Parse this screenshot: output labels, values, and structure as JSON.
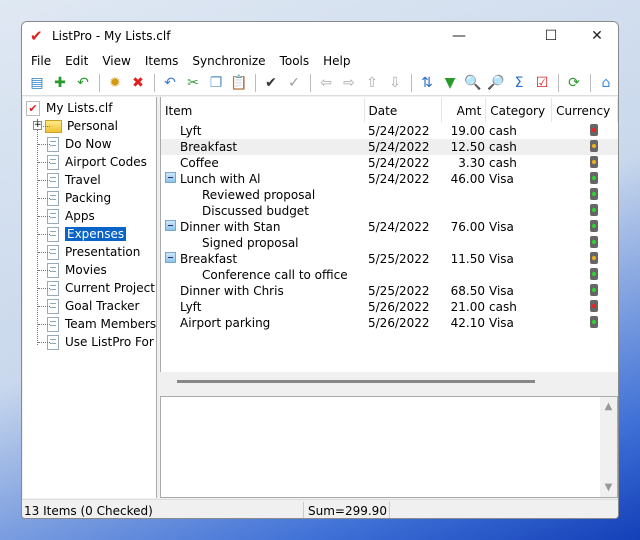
{
  "window": {
    "title": "ListPro - My Lists.clf",
    "minimize": "—",
    "maximize": "☐",
    "close": "✕"
  },
  "menu": [
    "File",
    "Edit",
    "View",
    "Items",
    "Synchronize",
    "Tools",
    "Help"
  ],
  "toolbar": [
    {
      "icon": "new-list-icon",
      "glyph": "▤",
      "color": "#2a7fc9"
    },
    {
      "icon": "add-item-icon",
      "glyph": "✚",
      "color": "#2a9a2a"
    },
    {
      "icon": "import-icon",
      "glyph": "↶",
      "color": "#2a9a2a"
    },
    "sep",
    {
      "icon": "settings-icon",
      "glyph": "✹",
      "color": "#d59a12"
    },
    {
      "icon": "delete-icon",
      "glyph": "✖",
      "color": "#e02020"
    },
    "sep",
    {
      "icon": "undo-icon",
      "glyph": "↶",
      "color": "#3a7cc9"
    },
    {
      "icon": "cut-icon",
      "glyph": "✂",
      "color": "#3a9a3a"
    },
    {
      "icon": "copy-icon",
      "glyph": "❐",
      "color": "#5a8fc9"
    },
    {
      "icon": "paste-icon",
      "glyph": "📋",
      "color": "#888"
    },
    "sep",
    {
      "icon": "check-icon",
      "glyph": "✔",
      "color": "#333"
    },
    {
      "icon": "uncheck-icon",
      "glyph": "✓",
      "color": "#999"
    },
    "sep",
    {
      "icon": "arrow-left-icon",
      "glyph": "⇦",
      "color": "#aaa"
    },
    {
      "icon": "arrow-right-icon",
      "glyph": "⇨",
      "color": "#aaa"
    },
    {
      "icon": "arrow-up-icon",
      "glyph": "⇧",
      "color": "#aaa"
    },
    {
      "icon": "arrow-down-icon",
      "glyph": "⇩",
      "color": "#aaa"
    },
    "sep",
    {
      "icon": "sort-icon",
      "glyph": "⇅",
      "color": "#2a6fc9"
    },
    {
      "icon": "filter-icon",
      "glyph": "▼",
      "color": "#2a9a2a"
    },
    {
      "icon": "find-icon",
      "glyph": "🔍",
      "color": "#2a6fc9"
    },
    {
      "icon": "find-next-icon",
      "glyph": "🔎",
      "color": "#2a6fc9"
    },
    {
      "icon": "sum-icon",
      "glyph": "Σ",
      "color": "#2a6fc9"
    },
    {
      "icon": "checklist-icon",
      "glyph": "☑",
      "color": "#e02020"
    },
    "sep",
    {
      "icon": "sync-icon",
      "glyph": "⟳",
      "color": "#2a9a2a"
    },
    "sep",
    {
      "icon": "home-icon",
      "glyph": "⌂",
      "color": "#3a8ad9"
    }
  ],
  "tree": {
    "root": "My Lists.clf",
    "items": [
      "Personal",
      "Do Now",
      "Airport Codes",
      "Travel",
      "Packing",
      "Apps",
      "Expenses",
      "Presentation",
      "Movies",
      "Current Project",
      "Goal Tracker",
      "Team Members",
      "Use ListPro For"
    ],
    "selected": "Expenses"
  },
  "columns": [
    "Item",
    "Date",
    "Amt",
    "Category",
    "Currency"
  ],
  "rows": [
    {
      "item": "Lyft",
      "date": "5/24/2022",
      "amt": "19.00",
      "cat": "cash",
      "light": "red",
      "level": 0
    },
    {
      "item": "Breakfast",
      "date": "5/24/2022",
      "amt": "12.50",
      "cat": "cash",
      "light": "yellow",
      "level": 0
    },
    {
      "item": "Coffee",
      "date": "5/24/2022",
      "amt": "3.30",
      "cat": "cash",
      "light": "yellow",
      "level": 0
    },
    {
      "item": "Lunch with Al",
      "date": "5/24/2022",
      "amt": "46.00",
      "cat": "Visa",
      "light": "green",
      "level": 0,
      "expanded": true
    },
    {
      "item": "Reviewed proposal",
      "date": "",
      "amt": "",
      "cat": "",
      "light": "green",
      "level": 1
    },
    {
      "item": "Discussed budget",
      "date": "",
      "amt": "",
      "cat": "",
      "light": "green",
      "level": 1
    },
    {
      "item": "Dinner with Stan",
      "date": "5/24/2022",
      "amt": "76.00",
      "cat": "Visa",
      "light": "green",
      "level": 0,
      "expanded": true
    },
    {
      "item": "Signed proposal",
      "date": "",
      "amt": "",
      "cat": "",
      "light": "green",
      "level": 1
    },
    {
      "item": "Breakfast",
      "date": "5/25/2022",
      "amt": "11.50",
      "cat": "Visa",
      "light": "yellow",
      "level": 0,
      "expanded": true
    },
    {
      "item": "Conference call to office",
      "date": "",
      "amt": "",
      "cat": "",
      "light": "green",
      "level": 1
    },
    {
      "item": "Dinner with Chris",
      "date": "5/25/2022",
      "amt": "68.50",
      "cat": "Visa",
      "light": "green",
      "level": 0
    },
    {
      "item": "Lyft",
      "date": "5/26/2022",
      "amt": "21.00",
      "cat": "cash",
      "light": "red",
      "level": 0
    },
    {
      "item": "Airport parking",
      "date": "5/26/2022",
      "amt": "42.10",
      "cat": "Visa",
      "light": "green",
      "level": 0
    }
  ],
  "light_colors": {
    "red": "#f02020",
    "yellow": "#f0b020",
    "green": "#30d030"
  },
  "status": {
    "count": "13 Items (0 Checked)",
    "sum": "Sum=299.90"
  }
}
